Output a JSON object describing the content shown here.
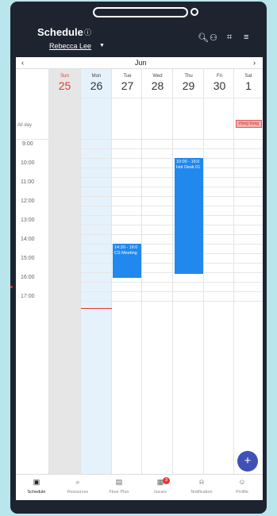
{
  "header": {
    "title": "Schedule",
    "help_icon": "ⓘ",
    "user": "Rebecca Lee"
  },
  "calendar": {
    "month": "Jun",
    "days": [
      {
        "name": "Sun",
        "num": "25"
      },
      {
        "name": "Mon",
        "num": "26"
      },
      {
        "name": "Tue",
        "num": "27"
      },
      {
        "name": "Wed",
        "num": "28"
      },
      {
        "name": "Thu",
        "num": "29"
      },
      {
        "name": "Fri",
        "num": "30"
      },
      {
        "name": "Sat",
        "num": "1"
      }
    ],
    "allday_label": "All day",
    "times": [
      "9:00",
      "10:00",
      "11:00",
      "12:00",
      "13:00",
      "14:00",
      "15:00",
      "16:00",
      "17:00"
    ],
    "holiday": "Hong Kong",
    "events": [
      {
        "time": "10:00 - 16:0",
        "title": "Hot Desk 01"
      },
      {
        "time": "14:30 - 16:0",
        "title": "CS Meeting"
      }
    ],
    "accent": "#2188ee",
    "sunday_color": "#e53935"
  },
  "fab": "+",
  "nav": [
    {
      "label": "Schedule",
      "icon": "calendar-icon"
    },
    {
      "label": "Resources",
      "icon": "search-icon"
    },
    {
      "label": "Floor Plan",
      "icon": "map-icon"
    },
    {
      "label": "Issues",
      "icon": "issues-icon",
      "badge": "3"
    },
    {
      "label": "Notification",
      "icon": "bell-icon"
    },
    {
      "label": "Profile",
      "icon": "person-icon"
    }
  ]
}
